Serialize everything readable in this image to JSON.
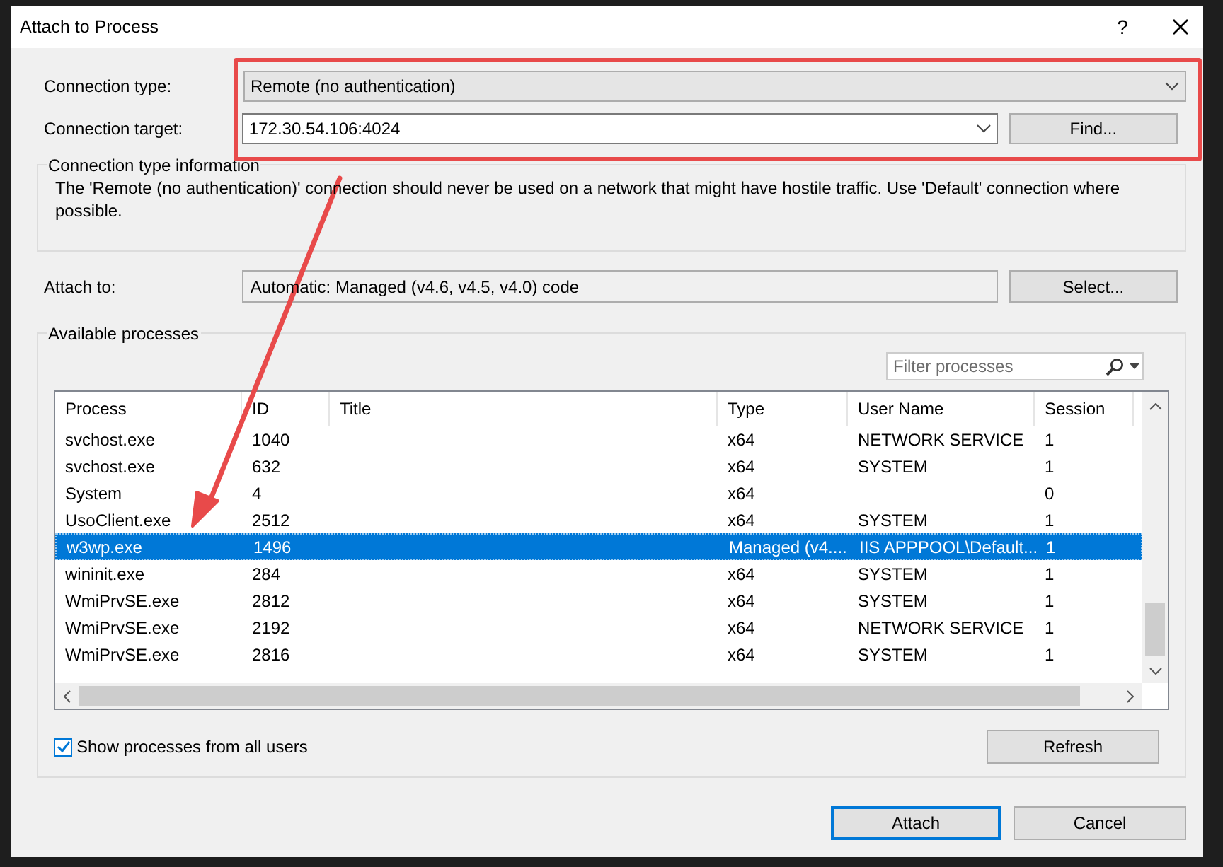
{
  "window": {
    "title": "Attach to Process",
    "help": "?"
  },
  "connection_type": {
    "label": "Connection type:",
    "value": "Remote (no authentication)"
  },
  "connection_target": {
    "label": "Connection target:",
    "value": "172.30.54.106:4024",
    "button": "Find..."
  },
  "connection_info": {
    "title": "Connection type information",
    "text": "The 'Remote (no authentication)' connection should never be used on a network that might have hostile traffic. Use 'Default' connection where possible."
  },
  "attach_to": {
    "label": "Attach to:",
    "value": "Automatic: Managed (v4.6, v4.5, v4.0) code",
    "button": "Select..."
  },
  "available_processes": {
    "title": "Available processes",
    "filter": {
      "placeholder": "Filter processes"
    },
    "table": {
      "columns": [
        "Process",
        "ID",
        "Title",
        "Type",
        "User Name",
        "Session"
      ],
      "rows": [
        {
          "cells": [
            "svchost.exe",
            "1040",
            "",
            "x64",
            "NETWORK SERVICE",
            "1"
          ],
          "selected": false
        },
        {
          "cells": [
            "svchost.exe",
            "632",
            "",
            "x64",
            "SYSTEM",
            "1"
          ],
          "selected": false
        },
        {
          "cells": [
            "System",
            "4",
            "",
            "x64",
            "",
            "0"
          ],
          "selected": false
        },
        {
          "cells": [
            "UsoClient.exe",
            "2512",
            "",
            "x64",
            "SYSTEM",
            "1"
          ],
          "selected": false
        },
        {
          "cells": [
            "w3wp.exe",
            "1496",
            "",
            "Managed (v4....",
            "IIS APPPOOL\\Default...",
            "1"
          ],
          "selected": true
        },
        {
          "cells": [
            "wininit.exe",
            "284",
            "",
            "x64",
            "SYSTEM",
            "1"
          ],
          "selected": false
        },
        {
          "cells": [
            "WmiPrvSE.exe",
            "2812",
            "",
            "x64",
            "SYSTEM",
            "1"
          ],
          "selected": false
        },
        {
          "cells": [
            "WmiPrvSE.exe",
            "2192",
            "",
            "x64",
            "NETWORK SERVICE",
            "1"
          ],
          "selected": false
        },
        {
          "cells": [
            "WmiPrvSE.exe",
            "2816",
            "",
            "x64",
            "SYSTEM",
            "1"
          ],
          "selected": false
        }
      ]
    },
    "show_all_users": {
      "label": "Show processes from all users",
      "checked": true
    },
    "refresh": "Refresh"
  },
  "buttons": [
    {
      "label": "Attach",
      "default": true
    },
    {
      "label": "Cancel",
      "default": false
    }
  ]
}
